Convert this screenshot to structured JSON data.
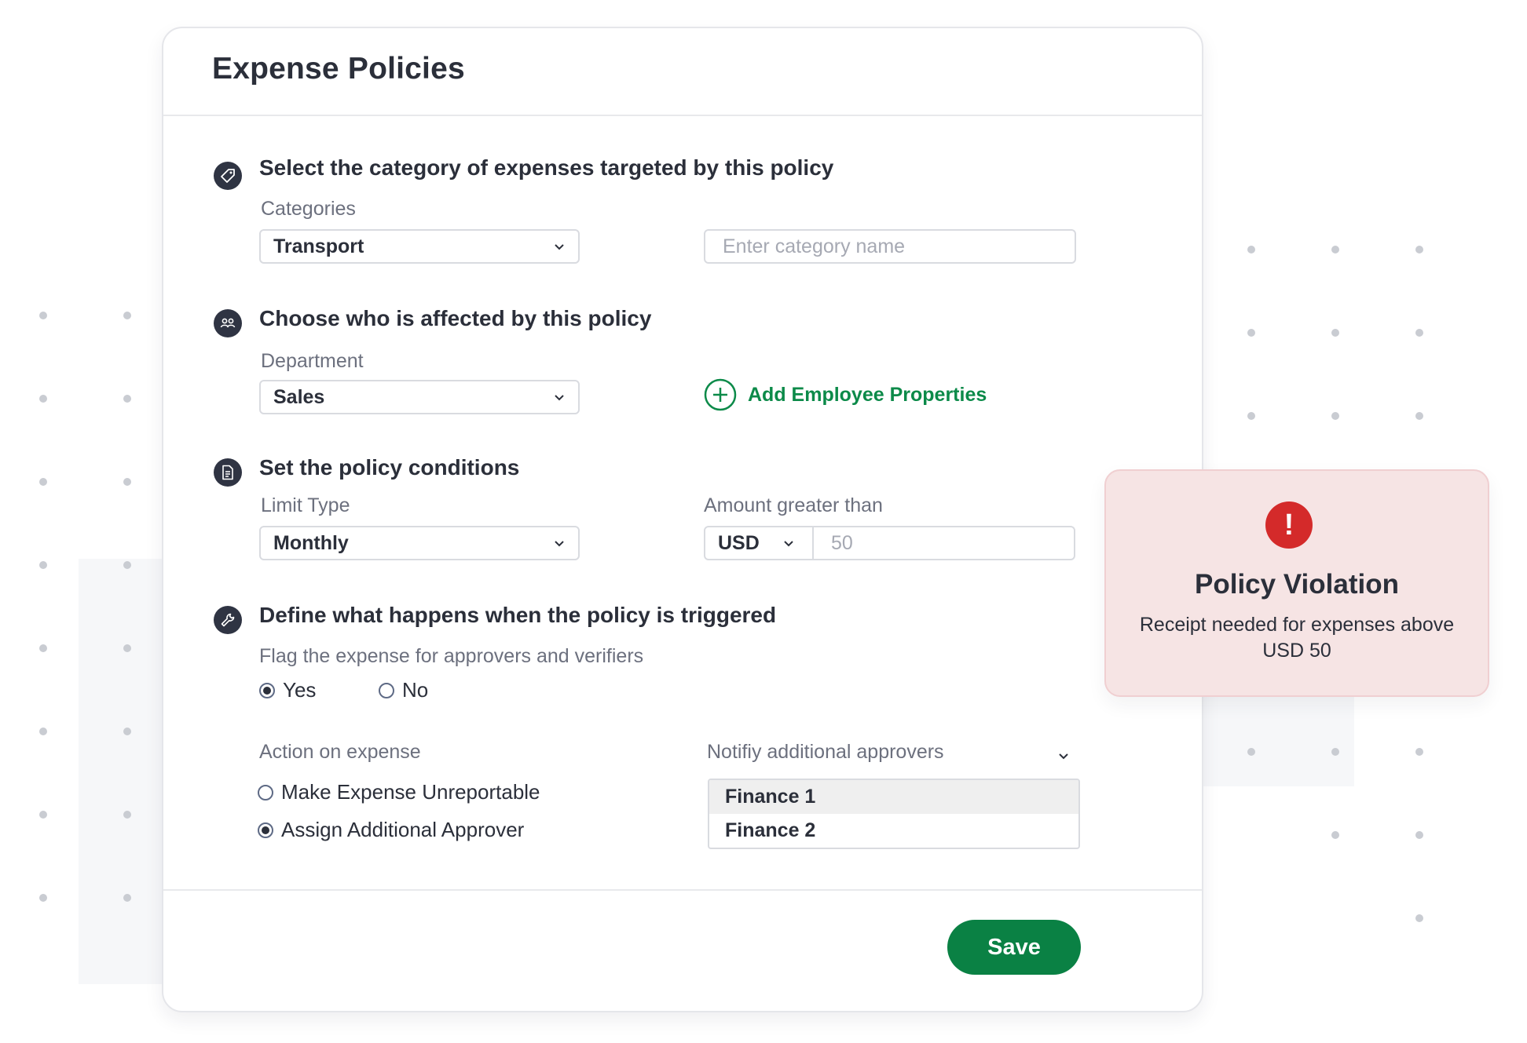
{
  "header": {
    "title": "Expense Policies"
  },
  "sections": [
    {
      "icon": "tag-icon",
      "title": "Select the category of expenses targeted by this policy",
      "field_label": "Categories",
      "select_value": "Transport",
      "input_placeholder": "Enter category name"
    },
    {
      "icon": "people-icon",
      "title": "Choose who is affected by this policy",
      "field_label": "Department",
      "select_value": "Sales",
      "add_link_label": "Add Employee Properties"
    },
    {
      "icon": "document-icon",
      "title": "Set the policy conditions",
      "field_label": "Limit Type",
      "select_value": "Monthly",
      "amount_label": "Amount greater than",
      "currency": "USD",
      "amount_placeholder": "50"
    },
    {
      "icon": "wrench-icon",
      "title": "Define what happens when the policy is triggered",
      "flag_label": "Flag the expense for approvers and verifiers",
      "flag_options": [
        {
          "label": "Yes",
          "checked": true
        },
        {
          "label": "No",
          "checked": false
        }
      ],
      "action_label": "Action on expense",
      "action_options": [
        {
          "label": "Make Expense Unreportable",
          "checked": false
        },
        {
          "label": "Assign Additional Approver",
          "checked": true
        }
      ],
      "notify_label": "Notifiy additional approvers",
      "approvers": [
        {
          "label": "Finance 1",
          "selected": true
        },
        {
          "label": "Finance 2",
          "selected": false
        }
      ]
    }
  ],
  "footer": {
    "save_label": "Save"
  },
  "toast": {
    "title": "Policy Violation",
    "message": "Receipt needed for expenses above USD 50"
  },
  "colors": {
    "accent_green": "#0a8144",
    "link_green": "#0c8a49",
    "alert_red": "#d42a2a",
    "toast_bg": "#f6e4e4",
    "icon_dark": "#2f3443"
  }
}
